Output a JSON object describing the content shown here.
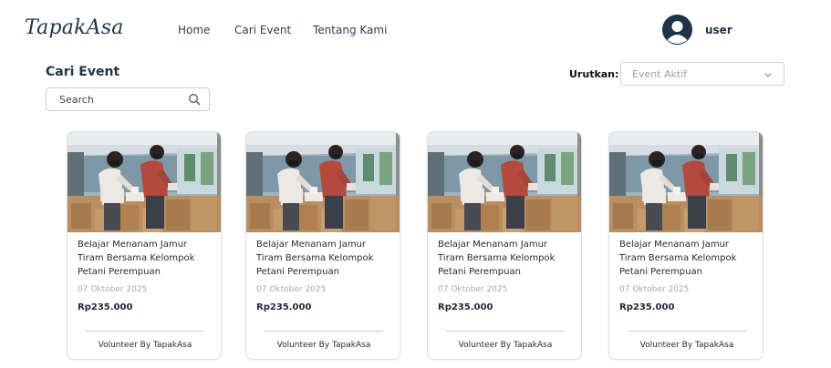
{
  "brand": {
    "logo_text": "TapakAsa",
    "primary_color": "#1f3447"
  },
  "nav": {
    "items": [
      {
        "label": "Home"
      },
      {
        "label": "Cari Event"
      },
      {
        "label": "Tentang Kami"
      }
    ]
  },
  "user": {
    "name": "user",
    "avatar_icon": "user-avatar-icon"
  },
  "page": {
    "title": "Cari Event"
  },
  "search": {
    "placeholder": "Search",
    "value": "",
    "icon": "search-icon"
  },
  "sort": {
    "label": "Urutkan:",
    "selected": "Event Aktif",
    "icon": "chevron-down-icon"
  },
  "events": [
    {
      "title": "Belajar Menanam Jamur Tiram Bersama Kelompok Petani Perempuan",
      "date": "07 Oktober 2025",
      "price": "Rp235.000",
      "footer": "Volunteer By TapakAsa"
    },
    {
      "title": "Belajar Menanam Jamur Tiram Bersama Kelompok Petani Perempuan",
      "date": "07 Oktober 2025",
      "price": "Rp235.000",
      "footer": "Volunteer By TapakAsa"
    },
    {
      "title": "Belajar Menanam Jamur Tiram Bersama Kelompok Petani Perempuan",
      "date": "07 Oktober 2025",
      "price": "Rp235.000",
      "footer": "Volunteer By TapakAsa"
    },
    {
      "title": "Belajar Menanam Jamur Tiram Bersama Kelompok Petani Perempuan",
      "date": "07 Oktober 2025",
      "price": "Rp235.000",
      "footer": "Volunteer By TapakAsa"
    }
  ]
}
